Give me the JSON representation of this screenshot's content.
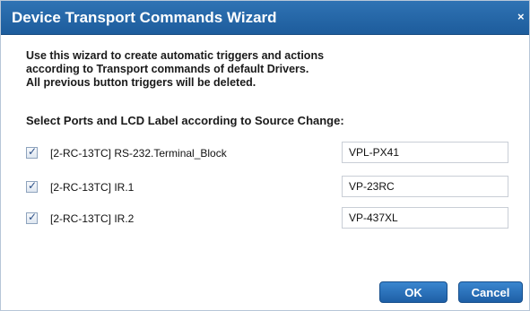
{
  "dialog": {
    "title": "Device Transport Commands Wizard",
    "close_glyph": "×",
    "intro_lines": [
      "Use this wizard to create automatic triggers and actions",
      "according to Transport commands of default Drivers.",
      "All previous button triggers will be deleted."
    ],
    "section_label": "Select Ports and LCD Label according to Source Change:",
    "ports": [
      {
        "checked": true,
        "label": "[2-RC-13TC] RS-232.Terminal_Block",
        "lcd_value": "VPL-PX41"
      },
      {
        "checked": true,
        "label": "[2-RC-13TC] IR.1",
        "lcd_value": "VP-23RC"
      },
      {
        "checked": true,
        "label": "[2-RC-13TC] IR.2",
        "lcd_value": "VP-437XL"
      }
    ],
    "buttons": {
      "ok": "OK",
      "cancel": "Cancel"
    },
    "colors": {
      "titlebar": "#2a6db0",
      "button": "#2b74c0"
    }
  }
}
